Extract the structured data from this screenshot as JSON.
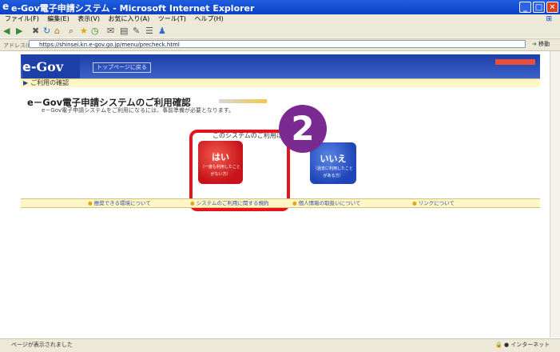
{
  "window": {
    "title": "e-Gov電子申請システム - Microsoft Internet Explorer"
  },
  "menu": [
    "ファイル(F)",
    "編集(E)",
    "表示(V)",
    "お気に入り(A)",
    "ツール(T)",
    "ヘルプ(H)"
  ],
  "address": {
    "label": "アドレス(D)",
    "url": "https://shinsei.kn.e-gov.go.jp/menu/precheck.html",
    "go_label": "移動"
  },
  "banner": {
    "logo_prefix": "e-",
    "logo_gov": "Gov",
    "top_link": "トップページに戻る"
  },
  "breadcrumb": "ご利用の確認",
  "heading": "e－Gov電子申請システムのご利用確認",
  "subtext": "e－Gov電子申請システムをご利用になるには、事前準備が必要となります。",
  "question": "このシステムのご利用は初めてですか？",
  "yes_button": {
    "main": "はい",
    "sub1": "（一度も利用したこと",
    "sub2": "がない方）"
  },
  "no_button": {
    "main": "いいえ",
    "sub1": "（過去に利用したこと",
    "sub2": "がある方）"
  },
  "step_number": "2",
  "footer_links": [
    "推奨できる環境について",
    "システムのご利用に関する規約",
    "個人情報の取扱いについて",
    "リンクについて"
  ],
  "status": {
    "left": "ページが表示されました",
    "right": "インターネット"
  },
  "colors": {
    "highlight": "#e8141c",
    "step_badge": "#7a2a90",
    "yes": "#d3161e",
    "no": "#2a52c4"
  }
}
